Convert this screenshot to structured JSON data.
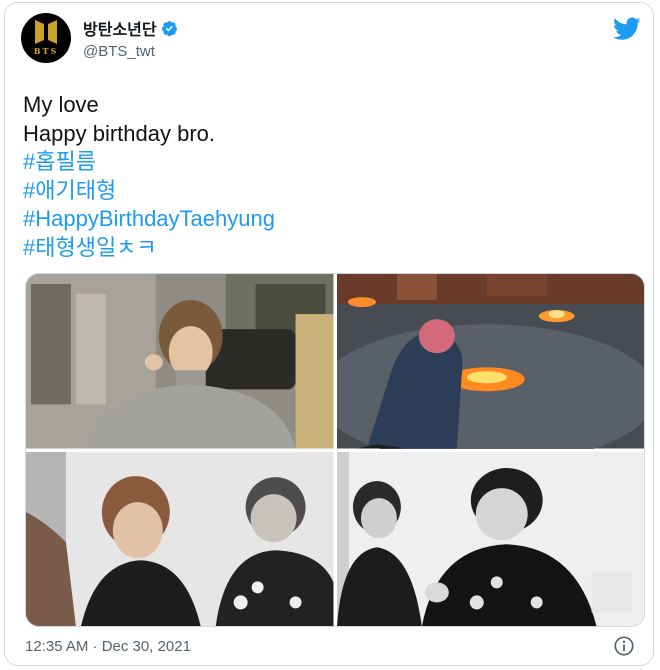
{
  "tweet": {
    "author": {
      "display_name": "방탄소년단",
      "handle": "@BTS_twt",
      "verified": true,
      "avatar_text": "BTS"
    },
    "lines": [
      "My love",
      "Happy birthday bro."
    ],
    "hashtags": [
      "#홉필름",
      "#애기태형",
      "#HappyBirthdayTaehyung",
      "#태형생일ㅊㅋ"
    ],
    "timestamp": "12:35 AM · Dec 30, 2021"
  },
  "colors": {
    "link": "#1d9bf0",
    "text": "#0f1419",
    "muted": "#536471",
    "border": "#cfd9de"
  },
  "icons": [
    "twitter-bird-icon",
    "verified-badge-icon",
    "info-icon"
  ]
}
